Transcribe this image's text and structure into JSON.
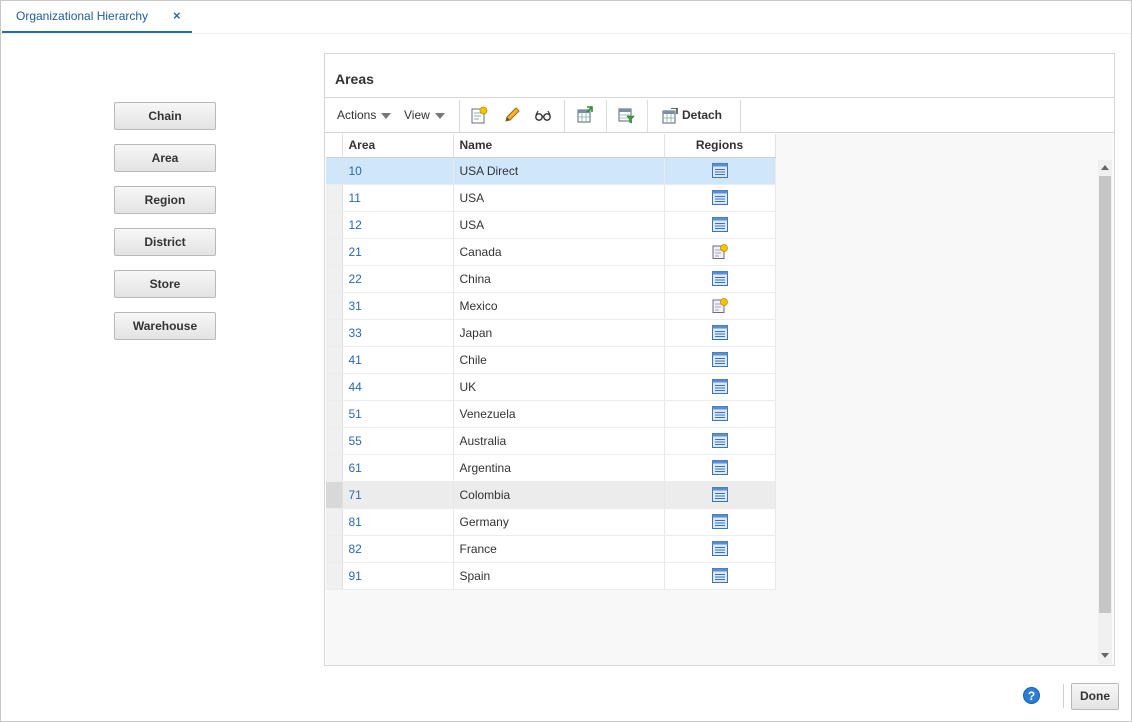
{
  "tab": {
    "label": "Organizational Hierarchy",
    "close": "×"
  },
  "nav": {
    "chain": "Chain",
    "area": "Area",
    "region": "Region",
    "district": "District",
    "store": "Store",
    "warehouse": "Warehouse"
  },
  "panel": {
    "title": "Areas",
    "toolbar": {
      "actions": "Actions",
      "view": "View",
      "detach": "Detach"
    },
    "columns": {
      "area": "Area",
      "name": "Name",
      "regions": "Regions"
    },
    "rows": [
      {
        "area": "10",
        "name": "USA Direct",
        "regions_icon": "regions-list-icon"
      },
      {
        "area": "11",
        "name": "USA",
        "regions_icon": "regions-list-icon"
      },
      {
        "area": "12",
        "name": "USA",
        "regions_icon": "regions-list-icon"
      },
      {
        "area": "21",
        "name": "Canada",
        "regions_icon": "regions-add-icon"
      },
      {
        "area": "22",
        "name": "China",
        "regions_icon": "regions-list-icon"
      },
      {
        "area": "31",
        "name": "Mexico",
        "regions_icon": "regions-add-icon"
      },
      {
        "area": "33",
        "name": "Japan",
        "regions_icon": "regions-list-icon"
      },
      {
        "area": "41",
        "name": "Chile",
        "regions_icon": "regions-list-icon"
      },
      {
        "area": "44",
        "name": "UK",
        "regions_icon": "regions-list-icon"
      },
      {
        "area": "51",
        "name": "Venezuela",
        "regions_icon": "regions-list-icon"
      },
      {
        "area": "55",
        "name": "Australia",
        "regions_icon": "regions-list-icon"
      },
      {
        "area": "61",
        "name": "Argentina",
        "regions_icon": "regions-list-icon"
      },
      {
        "area": "71",
        "name": "Colombia",
        "regions_icon": "regions-list-icon"
      },
      {
        "area": "81",
        "name": "Germany",
        "regions_icon": "regions-list-icon"
      },
      {
        "area": "82",
        "name": "France",
        "regions_icon": "regions-list-icon"
      },
      {
        "area": "91",
        "name": "Spain",
        "regions_icon": "regions-list-icon"
      }
    ]
  },
  "footer": {
    "help": "?",
    "done": "Done"
  },
  "colors": {
    "accent": "#2a6aa7",
    "selected_row": "#cfe6fb"
  }
}
